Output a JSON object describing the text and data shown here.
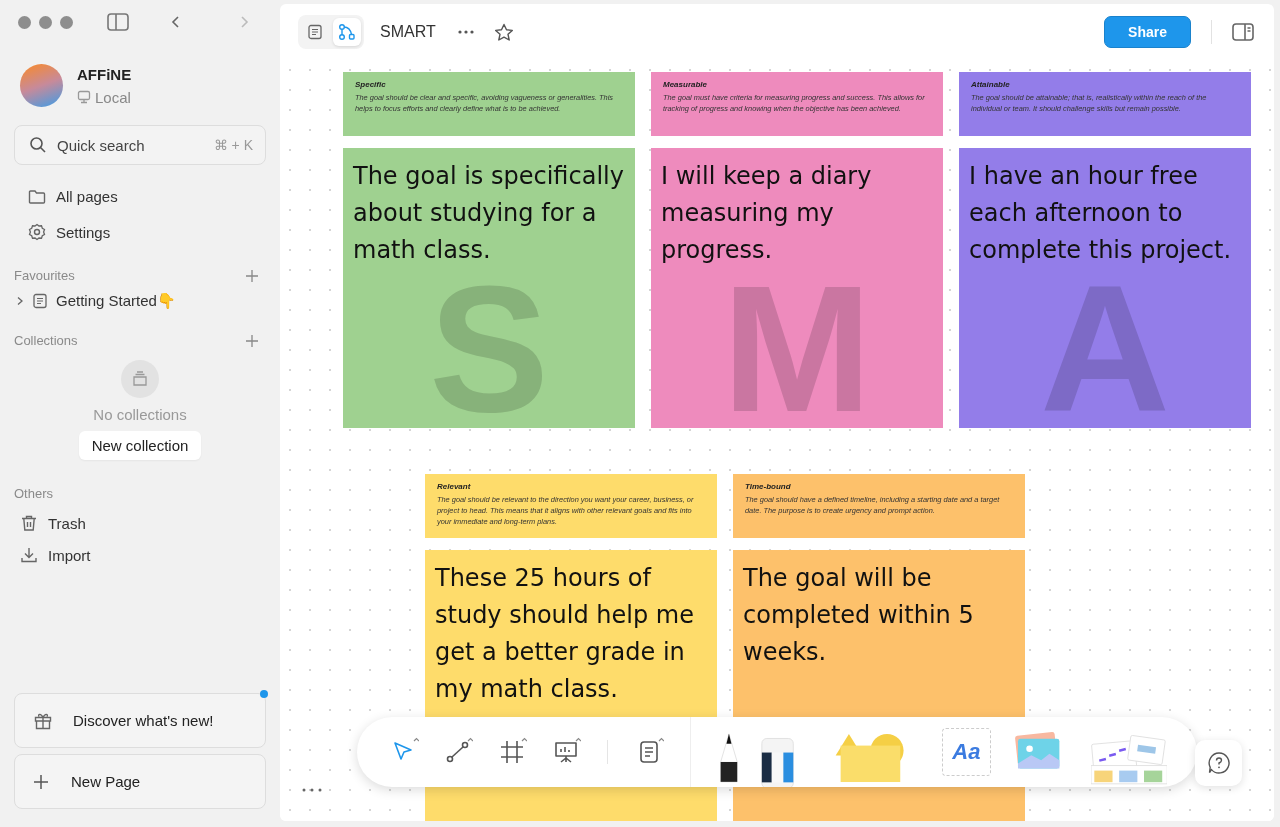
{
  "sidebar": {
    "workspace": {
      "name": "AFFiNE",
      "storage": "Local"
    },
    "search": {
      "placeholder": "Quick search",
      "shortcut": "⌘ + K"
    },
    "nav": [
      {
        "kind": "folder",
        "label": "All pages"
      },
      {
        "kind": "gear",
        "label": "Settings"
      }
    ],
    "favourites": {
      "title": "Favourites",
      "items": [
        {
          "label": "Getting Started👇",
          "expanded": false
        }
      ]
    },
    "collections": {
      "title": "Collections",
      "empty_text": "No collections",
      "button": "New collection"
    },
    "others": {
      "title": "Others",
      "items": [
        {
          "kind": "trash",
          "label": "Trash"
        },
        {
          "kind": "import",
          "label": "Import"
        }
      ]
    },
    "discover": {
      "label": "Discover what's new!",
      "unread": true
    },
    "new_page": "New Page"
  },
  "header": {
    "modes": [
      {
        "kind": "page",
        "selected": false
      },
      {
        "kind": "edgeless",
        "selected": true
      }
    ],
    "title": "SMART",
    "share": "Share"
  },
  "canvas": {
    "rows": [
      {
        "notes": [
          {
            "title": "Specific",
            "description": "The goal should be clear and specific, avoiding vagueness or generalities. This helps to focus efforts and clearly define what is to be achieved.",
            "statement": "The goal is specifically about studying for a math class.",
            "letter": "S",
            "color": "#9fd190"
          },
          {
            "title": "Measurable",
            "description": "The goal must have criteria for measuring progress and success. This allows for tracking of progress and knowing when the objective has been achieved.",
            "statement": "I will keep a diary measuring my progress.",
            "letter": "M",
            "color": "#ee8bbd"
          },
          {
            "title": "Attainable",
            "description": "The goal should be attainable; that is, realistically within the reach of the individual or team. It should challenge skills but remain possible.",
            "statement": "I have an hour free each afternoon to complete this project.",
            "letter": "A",
            "color": "#937de9"
          }
        ]
      },
      {
        "notes": [
          {
            "title": "Relevant",
            "description": "The goal should be relevant to the direction you want your career, business, or project to head. This means that it aligns with other relevant goals and fits into your immediate and long-term plans.",
            "statement": "These 25 hours of study should help me get a better grade in my math class.",
            "color": "#fedc6b"
          },
          {
            "title": "Time-bound",
            "description": "The goal should have a defined timeline, including a starting date and a target date. The purpose is to create urgency and prompt action.",
            "statement": "The goal will be completed within 5 weeks.",
            "color": "#fdc16b"
          }
        ]
      }
    ]
  },
  "toolbar": {
    "tools": [
      {
        "kind": "select",
        "selected": true
      },
      {
        "kind": "connector",
        "selected": false
      },
      {
        "kind": "frame",
        "selected": false
      },
      {
        "kind": "present",
        "selected": false
      },
      {
        "kind": "note",
        "selected": false
      }
    ],
    "text_tool": "Aa"
  }
}
